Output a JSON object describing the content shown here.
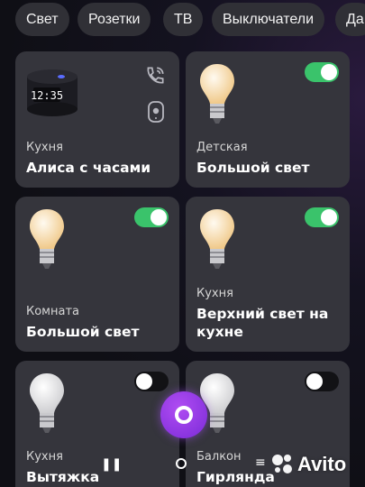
{
  "filters": [
    "Свет",
    "Розетки",
    "ТВ",
    "Выключатели",
    "Да"
  ],
  "devices": [
    {
      "room": "Кухня",
      "name": "Алиса с часами",
      "type": "speaker",
      "clock": "12:35",
      "icons": [
        "phone-call-icon",
        "intercom-icon"
      ]
    },
    {
      "room": "Детская",
      "name": "Большой свет",
      "type": "lamp-warm",
      "on": true
    },
    {
      "room": "Комната",
      "name": "Большой свет",
      "type": "lamp-warm",
      "on": true
    },
    {
      "room": "Кухня",
      "name": "Верхний свет на кухне",
      "type": "lamp-warm",
      "on": true
    },
    {
      "room": "Кухня",
      "name": "Вытяжка",
      "type": "lamp-white",
      "on": false
    },
    {
      "room": "Балкон",
      "name": "Гирлянда",
      "type": "lamp-white",
      "on": false
    }
  ],
  "colors": {
    "toggle_on": "#3ac36b",
    "card_bg": "#35353c",
    "alice": "#9a3ff0"
  },
  "watermark": "Avito"
}
